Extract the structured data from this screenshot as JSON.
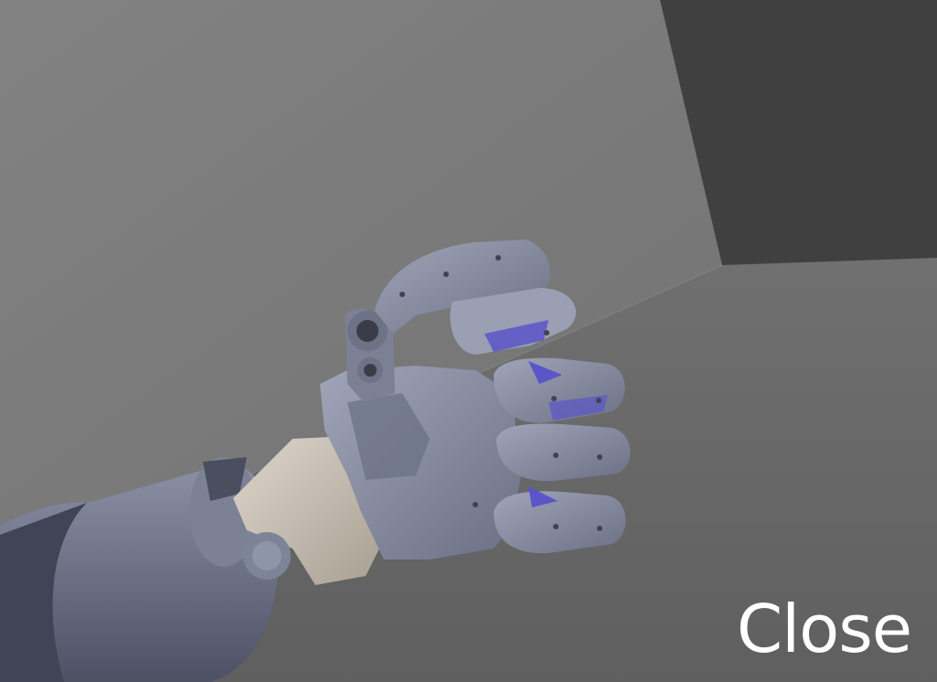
{
  "scene": {
    "description_icon": "robot-hand-icon"
  },
  "overlay": {
    "label": "Close"
  },
  "colors": {
    "wall_left": "#7a7a7a",
    "wall_right": "#3f3f3f",
    "floor": "#6a6a6a",
    "metal": "#8a8fa3",
    "metal_dark": "#5d6376",
    "accent_purple": "#5a55c8",
    "wrist_beige": "#c9c0b3"
  }
}
